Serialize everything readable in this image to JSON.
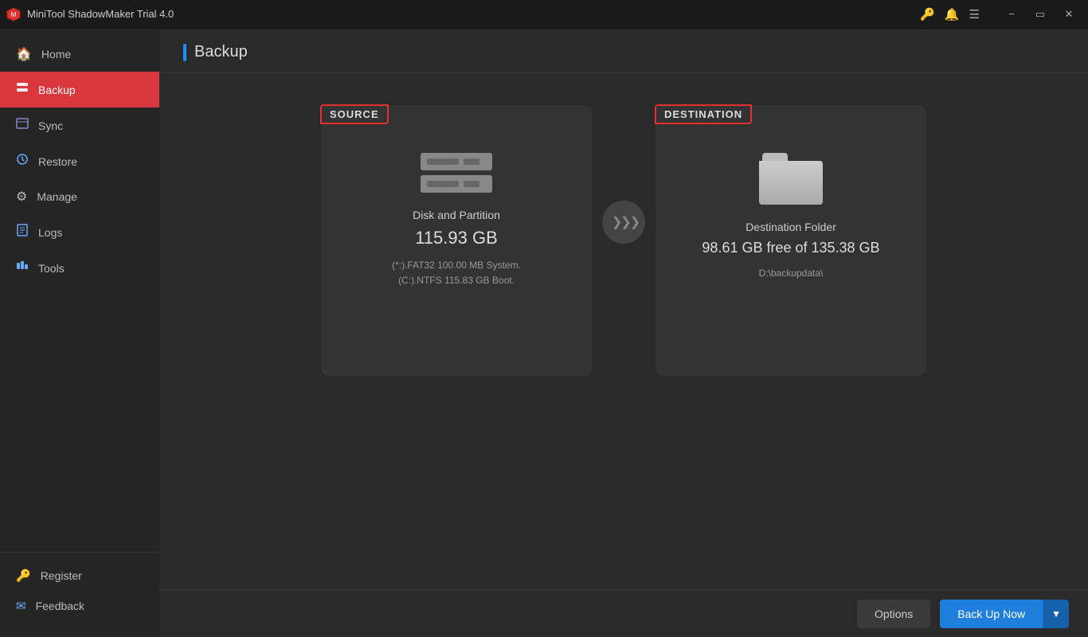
{
  "titlebar": {
    "title": "MiniTool ShadowMaker Trial 4.0",
    "logo_unicode": "🛡"
  },
  "sidebar": {
    "items": [
      {
        "id": "home",
        "label": "Home",
        "icon": "🏠",
        "active": false
      },
      {
        "id": "backup",
        "label": "Backup",
        "icon": "📋",
        "active": true
      },
      {
        "id": "sync",
        "label": "Sync",
        "icon": "📄",
        "active": false
      },
      {
        "id": "restore",
        "label": "Restore",
        "icon": "🔄",
        "active": false
      },
      {
        "id": "manage",
        "label": "Manage",
        "icon": "⚙",
        "active": false
      },
      {
        "id": "logs",
        "label": "Logs",
        "icon": "📋",
        "active": false
      },
      {
        "id": "tools",
        "label": "Tools",
        "icon": "🔧",
        "active": false
      }
    ],
    "bottom": [
      {
        "id": "register",
        "label": "Register",
        "icon": "🔑"
      },
      {
        "id": "feedback",
        "label": "Feedback",
        "icon": "✉"
      }
    ]
  },
  "page": {
    "title": "Backup"
  },
  "source_card": {
    "label": "SOURCE",
    "description": "Disk and Partition",
    "size": "115.93 GB",
    "detail_line1": "(*:).FAT32 100.00 MB System.",
    "detail_line2": "(C:).NTFS 115.83 GB Boot."
  },
  "destination_card": {
    "label": "DESTINATION",
    "description": "Destination Folder",
    "size": "98.61 GB free of 135.38 GB",
    "path": "D:\\backupdata\\"
  },
  "arrow": ">>>",
  "buttons": {
    "options": "Options",
    "backup_now": "Back Up Now",
    "dropdown_arrow": "▼"
  }
}
